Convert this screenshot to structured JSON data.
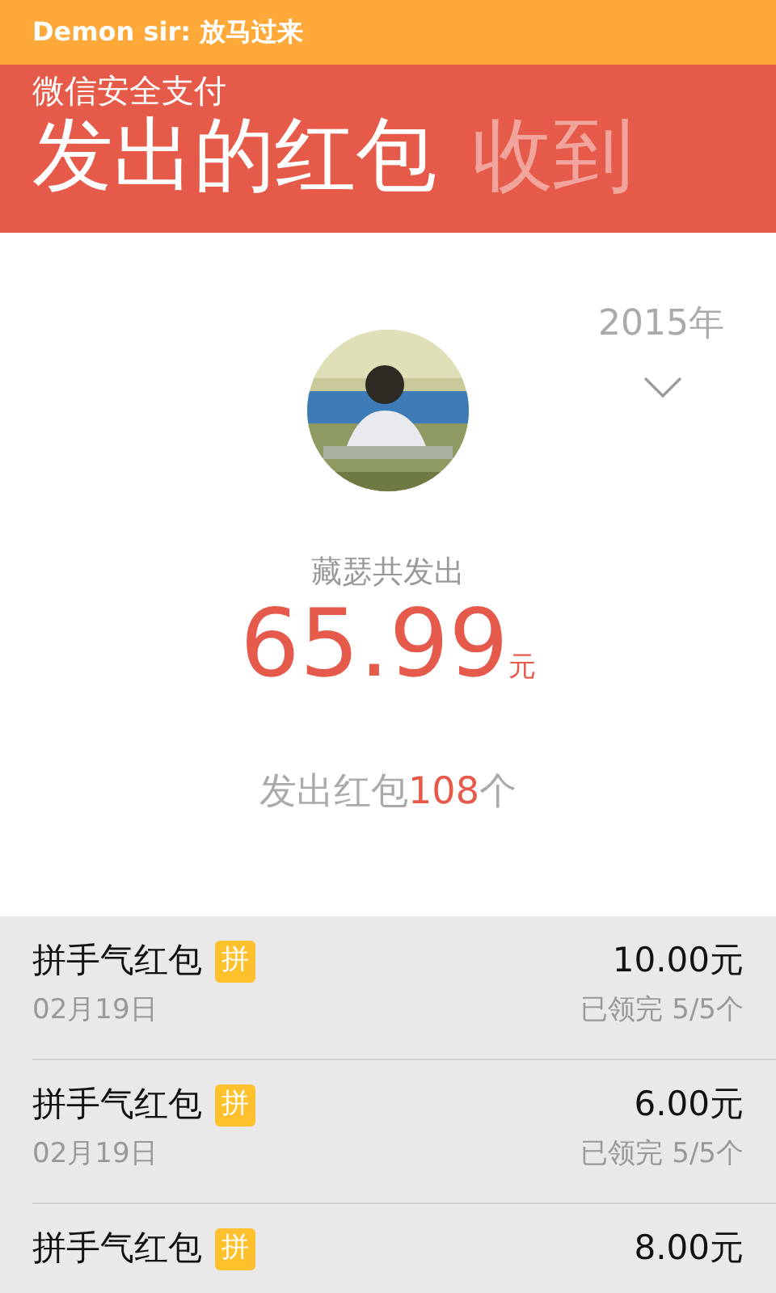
{
  "status_bar": {
    "notification": "Demon sir: 放马过来"
  },
  "header": {
    "app_title": "微信安全支付",
    "pivots": [
      {
        "label": "发出的红包",
        "selected": true
      },
      {
        "label": "收到",
        "selected": false
      }
    ]
  },
  "summary": {
    "year": "2015年",
    "caption": "藏瑟共发出",
    "amount": "65.99",
    "unit": "元",
    "count_prefix": "发出红包",
    "count": "108",
    "count_suffix": "个"
  },
  "records": [
    {
      "title": "拼手气红包",
      "badge": "拼",
      "amount": "10.00元",
      "date": "02月19日",
      "status": "已领完 5/5个"
    },
    {
      "title": "拼手气红包",
      "badge": "拼",
      "amount": "6.00元",
      "date": "02月19日",
      "status": "已领完 5/5个"
    },
    {
      "title": "拼手气红包",
      "badge": "拼",
      "amount": "8.00元"
    }
  ]
}
